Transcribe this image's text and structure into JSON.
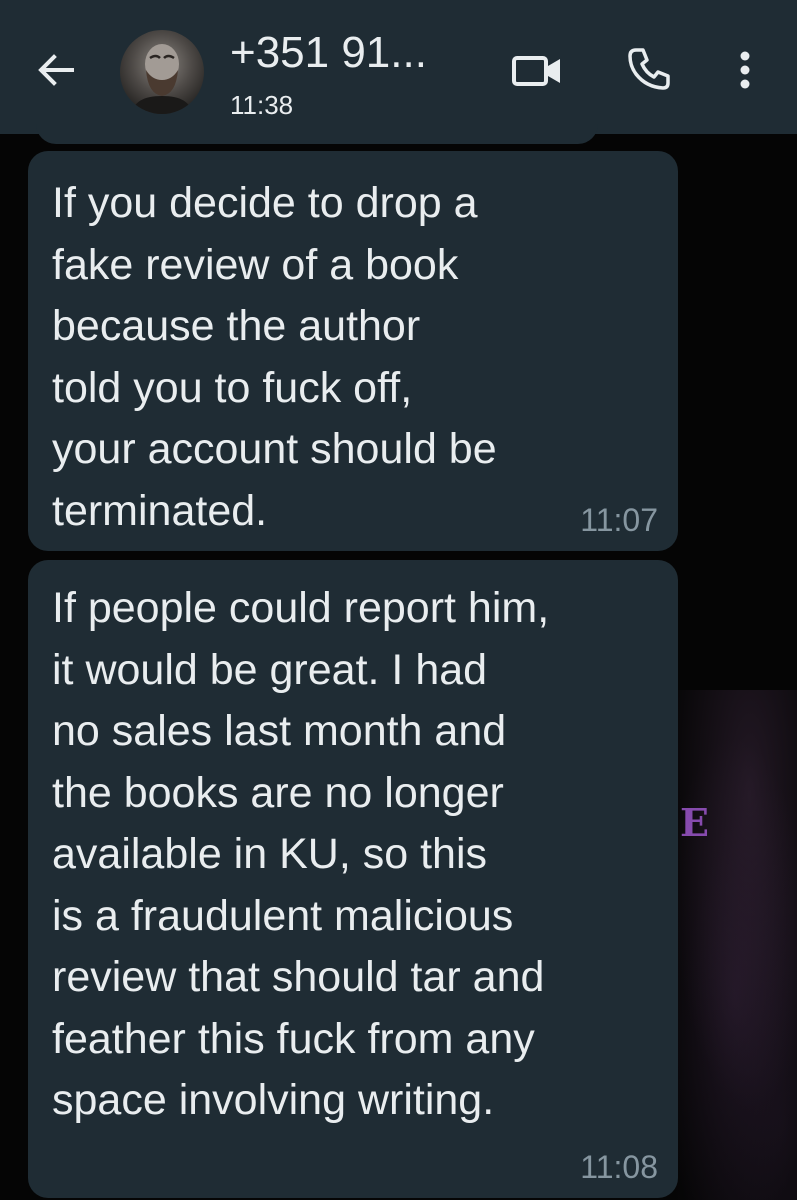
{
  "header": {
    "contact_name": "+351 91...",
    "status": "11:38",
    "icons": {
      "back": "arrow-left-icon",
      "video": "video-camera-icon",
      "call": "phone-icon",
      "menu": "more-vertical-icon"
    }
  },
  "wallpaper": {
    "letter": "E"
  },
  "messages": [
    {
      "text": "If you decide to drop a\nfake review of a book\nbecause the author\ntold you to fuck off,\nyour account should be\nterminated.",
      "time": "11:07"
    },
    {
      "text": "If people could report him,\nit would be great. I had\nno sales last month and\nthe books are no longer\navailable in KU, so this\nis a fraudulent malicious\nreview that should tar and\nfeather this fuck from any\nspace involving writing.",
      "time": "11:08"
    }
  ],
  "colors": {
    "header_bg": "#1f2c34",
    "bubble_bg": "#1f2c34",
    "text": "#e9edef",
    "timestamp": "#8696a0",
    "chat_bg": "#050505"
  }
}
